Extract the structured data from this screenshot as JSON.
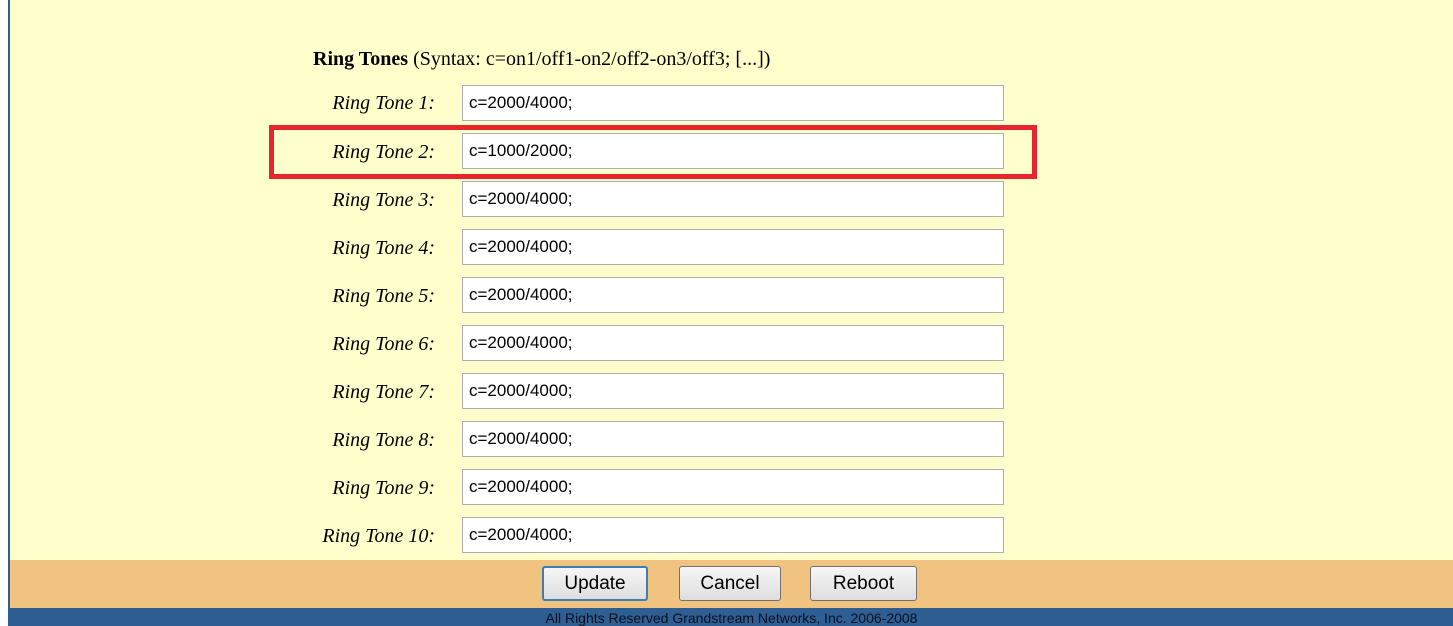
{
  "section": {
    "title_bold": "Ring Tones",
    "title_syntax": " (Syntax: c=on1/off1-on2/off2-on3/off3; [...])"
  },
  "ring_tones": [
    {
      "label": "Ring Tone 1:",
      "value": "c=2000/4000;"
    },
    {
      "label": "Ring Tone 2:",
      "value": "c=1000/2000;"
    },
    {
      "label": "Ring Tone 3:",
      "value": "c=2000/4000;"
    },
    {
      "label": "Ring Tone 4:",
      "value": "c=2000/4000;"
    },
    {
      "label": "Ring Tone 5:",
      "value": "c=2000/4000;"
    },
    {
      "label": "Ring Tone 6:",
      "value": "c=2000/4000;"
    },
    {
      "label": "Ring Tone 7:",
      "value": "c=2000/4000;"
    },
    {
      "label": "Ring Tone 8:",
      "value": "c=2000/4000;"
    },
    {
      "label": "Ring Tone 9:",
      "value": "c=2000/4000;"
    },
    {
      "label": "Ring Tone 10:",
      "value": "c=2000/4000;"
    }
  ],
  "buttons": {
    "update": "Update",
    "cancel": "Cancel",
    "reboot": "Reboot"
  },
  "footer": {
    "copyright": "All Rights Reserved Grandstream Networks, Inc. 2006-2008"
  },
  "colors": {
    "panel_background": "#ffffcc",
    "button_bar": "#f0c480",
    "footer_bar": "#2f5e92",
    "highlight": "#e5262d"
  }
}
